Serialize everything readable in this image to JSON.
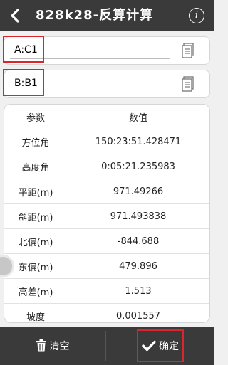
{
  "header": {
    "back_icon": "chevron-left-icon",
    "title": "828k28-反算计算",
    "info_label": "i"
  },
  "fields": {
    "point_a": "A:C1",
    "point_b": "B:B1",
    "doc_icon": "document-icon"
  },
  "table": {
    "headers": [
      "参数",
      "数值"
    ],
    "rows": [
      {
        "key": "方位角",
        "value": "150:23:51.428471"
      },
      {
        "key": "高度角",
        "value": "0:05:21.235983"
      },
      {
        "key": "平距(m)",
        "value": "971.49266"
      },
      {
        "key": "斜距(m)",
        "value": "971.493838"
      },
      {
        "key": "北偏(m)",
        "value": "-844.688"
      },
      {
        "key": "东偏(m)",
        "value": "479.896"
      },
      {
        "key": "高差(m)",
        "value": "1.513"
      },
      {
        "key": "坡度",
        "value": "0.001557"
      }
    ]
  },
  "footer": {
    "clear_label": "清空",
    "ok_label": "确定"
  },
  "colors": {
    "bar": "#3a3a3a",
    "highlight": "#d9262c"
  }
}
